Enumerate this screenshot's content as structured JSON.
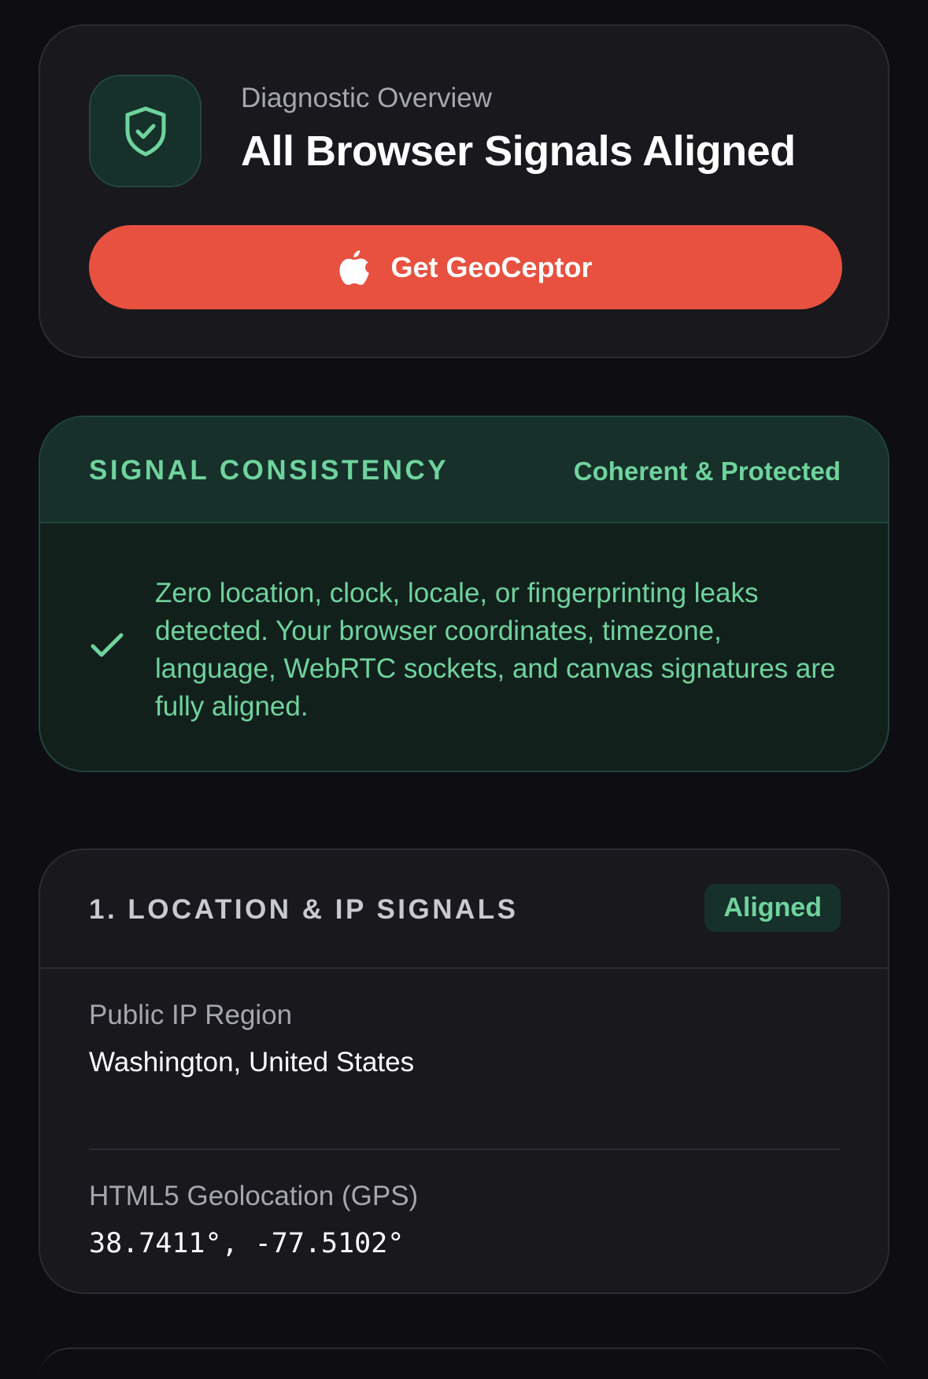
{
  "overview": {
    "kicker": "Diagnostic Overview",
    "title": "All Browser Signals Aligned",
    "icon": "shield-check-icon",
    "cta": {
      "label": "Get GeoCeptor",
      "icon": "apple-icon"
    }
  },
  "consistency": {
    "title": "SIGNAL CONSISTENCY",
    "status": "Coherent & Protected",
    "icon": "check-icon",
    "body": "Zero location, clock, locale, or fingerprinting leaks detected. Your browser coordinates, timezone, language, WebRTC sockets, and canvas signatures are fully aligned."
  },
  "location": {
    "title": "1. LOCATION & IP SIGNALS",
    "badge": "Aligned",
    "fields": [
      {
        "label": "Public IP Region",
        "value": "Washington, United States"
      },
      {
        "label": "HTML5 Geolocation (GPS)",
        "value": "38.7411°, -77.5102°"
      }
    ]
  },
  "colors": {
    "background": "#0e0e12",
    "card": "#18181d",
    "accent_green": "#6fd39d",
    "cta_red": "#e8513f"
  }
}
